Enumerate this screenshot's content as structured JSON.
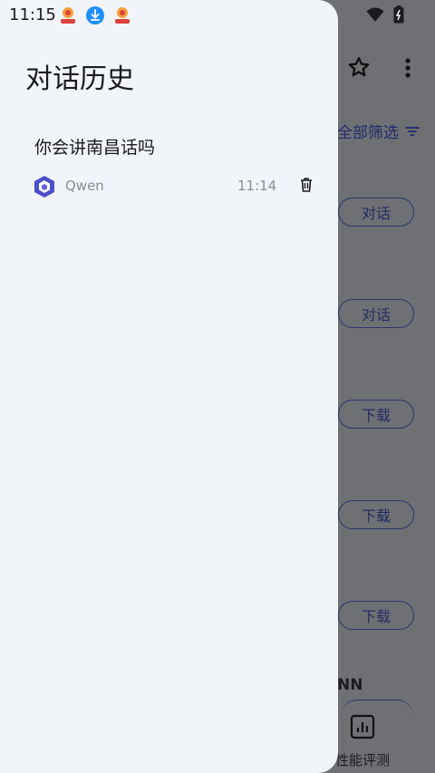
{
  "status": {
    "time": "11:15"
  },
  "drawer": {
    "title": "对话历史",
    "conversations": [
      {
        "title": "你会讲南昌话吗",
        "model": "Qwen",
        "time": "11:14"
      }
    ]
  },
  "background": {
    "filter_label": "全部筛选",
    "buttons": [
      "对话",
      "对话",
      "下载",
      "下载",
      "下载"
    ],
    "section_label": "NN",
    "bottom_nav_label": "性能评测"
  },
  "colors": {
    "drawer_bg": "#f1f4f8",
    "scrim": "#6f7074",
    "accent": "#2a3470"
  }
}
